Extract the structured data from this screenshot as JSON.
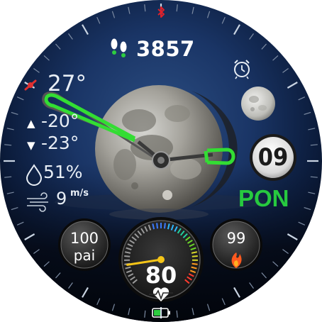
{
  "watchface": {
    "steps": "3857",
    "temperature": "27°",
    "temp_low": "-20°",
    "temp_high": "-23°",
    "temp_low_icon": "▲",
    "temp_high_icon": "▼",
    "humidity": "51%",
    "wind_speed": "9",
    "wind_unit": "m/s",
    "date": "09",
    "weekday": "PON",
    "pai_value": "100",
    "pai_label": "pai",
    "calories_value": "99",
    "heart_rate": "80",
    "heart_rate_fraction": 0.12,
    "battery_fraction": 0.5
  },
  "icons": {
    "bluetooth": "bluetooth-icon",
    "steps": "footsteps-icon",
    "alarm": "alarm-clock-icon",
    "weather": "moon-phase-icon",
    "humidity": "droplet-icon",
    "wind": "wind-icon",
    "calories": "flame-icon",
    "heart": "heart-pulse-icon",
    "battery": "battery-icon"
  },
  "colors": {
    "accent": "#2ecc40",
    "bluetooth": "#e0202a",
    "hr_needle": "#f5c518",
    "flame": "#ff5a1f",
    "battery": "#2ecc40"
  }
}
